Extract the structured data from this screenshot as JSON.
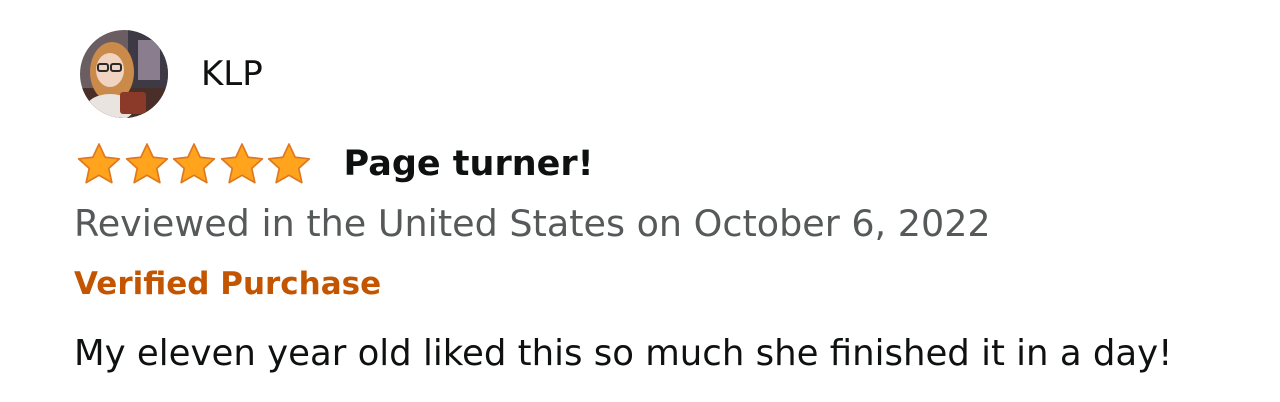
{
  "review": {
    "author": "KLP",
    "avatar_icon": "profile-photo",
    "rating": 5,
    "rating_max": 5,
    "title": "Page turner!",
    "date_line": "Reviewed in the United States on October 6, 2022",
    "badge": "Verified Purchase",
    "body": "My eleven year old liked this so much she finished it in a day!"
  },
  "colors": {
    "star_fill": "#ffa41c",
    "star_stroke": "#de7921",
    "verified": "#c45500",
    "secondary_text": "#565959",
    "primary_text": "#0f1111"
  }
}
